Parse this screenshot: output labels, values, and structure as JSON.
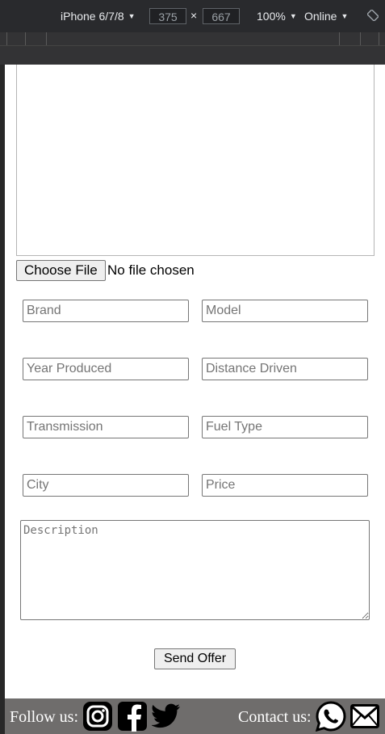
{
  "devtools": {
    "device": "iPhone 6/7/8",
    "width": "375",
    "times": "×",
    "height": "667",
    "zoom": "100%",
    "network": "Online",
    "rotate_icon": "rotate-icon"
  },
  "upload": {
    "choose_label": "Choose File",
    "status": "No file chosen"
  },
  "form": {
    "brand_placeholder": "Brand",
    "model_placeholder": "Model",
    "year_placeholder": "Year Produced",
    "distance_placeholder": "Distance Driven",
    "transmission_placeholder": "Transmission",
    "fuel_placeholder": "Fuel Type",
    "city_placeholder": "City",
    "price_placeholder": "Price",
    "description_placeholder": "Description",
    "send_label": "Send Offer"
  },
  "footer": {
    "follow_label": "Follow us:",
    "contact_label": "Contact us:",
    "social_icons": [
      "instagram-icon",
      "facebook-icon",
      "twitter-icon"
    ],
    "contact_icons": [
      "whatsapp-icon",
      "mail-icon"
    ],
    "background": "#6f6d6c"
  }
}
